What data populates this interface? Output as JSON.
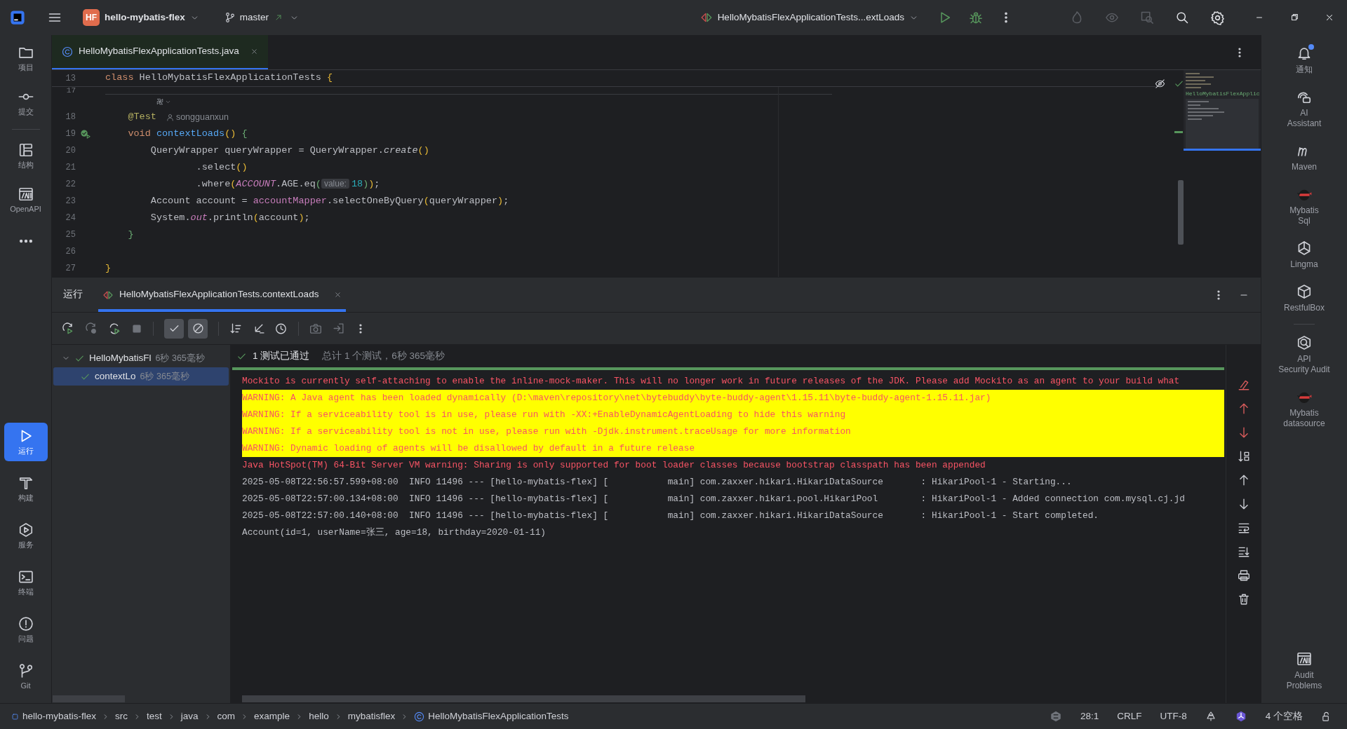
{
  "title_bar": {
    "project_badge": "HF",
    "project": "hello-mybatis-flex",
    "branch": "master",
    "run_config": "HelloMybatisFlexApplicationTests...extLoads"
  },
  "left_toolbar": {
    "top": [
      {
        "label": "项目",
        "selected": false
      },
      {
        "label": "提交",
        "selected": false
      },
      {
        "label": "结构",
        "selected": false
      },
      {
        "label": "OpenAPI",
        "selected": false
      }
    ],
    "bottom": [
      {
        "label": "运行",
        "selected": true
      },
      {
        "label": "构建",
        "selected": false
      },
      {
        "label": "服务",
        "selected": false
      },
      {
        "label": "终端",
        "selected": false
      },
      {
        "label": "问题",
        "selected": false
      },
      {
        "label": "Git",
        "selected": false
      }
    ]
  },
  "editor_tabs": [
    {
      "label": "HelloMybatisFlexApplicationTests.java",
      "selected": true
    }
  ],
  "editor": {
    "sticky_line": {
      "number": "13",
      "tokens": [
        {
          "t": "class ",
          "kind": "keyword"
        },
        {
          "t": "HelloMybatisFlexApplicationTests ",
          "kind": "plain"
        },
        {
          "t": "{",
          "kind": "bracket"
        }
      ]
    },
    "lines": [
      {
        "number": "17",
        "kind": "cut"
      },
      {
        "kind": "inlay"
      },
      {
        "number": "18",
        "kind": "code",
        "tokens": [
          {
            "t": "    @Test",
            "kind": "annotation"
          }
        ],
        "author": "songguanxun"
      },
      {
        "number": "19",
        "kind": "code",
        "run_marker": true,
        "tokens": [
          {
            "t": "    void ",
            "kind": "keyword"
          },
          {
            "t": "contextLoads",
            "kind": "function"
          },
          {
            "t": "() ",
            "kind": "bracket"
          },
          {
            "t": "{",
            "kind": "bracket2"
          }
        ]
      },
      {
        "number": "20",
        "kind": "code",
        "tokens": [
          {
            "t": "        QueryWrapper queryWrapper = QueryWrapper.",
            "kind": "plain"
          },
          {
            "t": "create",
            "kind": "italic"
          },
          {
            "t": "()",
            "kind": "bracket"
          }
        ]
      },
      {
        "number": "21",
        "kind": "code",
        "tokens": [
          {
            "t": "                .select",
            "kind": "plain"
          },
          {
            "t": "()",
            "kind": "bracket"
          }
        ]
      },
      {
        "number": "22",
        "kind": "code",
        "tokens": [
          {
            "t": "                .where",
            "kind": "plain"
          },
          {
            "t": "(",
            "kind": "bracket"
          },
          {
            "t": "ACCOUNT",
            "kind": "static"
          },
          {
            "t": ".AGE.eq",
            "kind": "plain"
          },
          {
            "t": "(",
            "kind": "bracket2"
          },
          {
            "t": "value:",
            "kind": "hint"
          },
          {
            "t": "18",
            "kind": "number"
          },
          {
            "t": ")",
            "kind": "bracket2"
          },
          {
            "t": ")",
            "kind": "bracket"
          },
          {
            "t": ";",
            "kind": "plain"
          }
        ]
      },
      {
        "number": "23",
        "kind": "code",
        "tokens": [
          {
            "t": "        Account account = ",
            "kind": "plain"
          },
          {
            "t": "accountMapper",
            "kind": "field"
          },
          {
            "t": ".selectOneByQuery",
            "kind": "plain"
          },
          {
            "t": "(",
            "kind": "bracket"
          },
          {
            "t": "queryWrapper",
            "kind": "plain"
          },
          {
            "t": ")",
            "kind": "bracket"
          },
          {
            "t": ";",
            "kind": "plain"
          }
        ]
      },
      {
        "number": "24",
        "kind": "code",
        "tokens": [
          {
            "t": "        System.",
            "kind": "plain"
          },
          {
            "t": "out",
            "kind": "static"
          },
          {
            "t": ".println",
            "kind": "plain"
          },
          {
            "t": "(",
            "kind": "bracket"
          },
          {
            "t": "account",
            "kind": "plain"
          },
          {
            "t": ")",
            "kind": "bracket"
          },
          {
            "t": ";",
            "kind": "plain"
          }
        ]
      },
      {
        "number": "25",
        "kind": "code",
        "tokens": [
          {
            "t": "    }",
            "kind": "bracket2"
          }
        ]
      },
      {
        "number": "26",
        "kind": "code"
      },
      {
        "number": "27",
        "kind": "code",
        "tokens": [
          {
            "t": "}",
            "kind": "bracket"
          }
        ]
      }
    ],
    "minimap_label": "HelloMybatisFlexApplic"
  },
  "run_panel": {
    "label": "运行",
    "tab": {
      "label": "HelloMybatisFlexApplicationTests.contextLoads",
      "selected": true
    },
    "filters": [
      {
        "on": true
      },
      {
        "on": true
      }
    ],
    "progress": {
      "level": 1
    },
    "tree": [
      {
        "name": "HelloMybatisFl",
        "time": "6秒 365毫秒",
        "passed": true,
        "expanded": true,
        "selected": false,
        "children": [
          {
            "name": "contextLo",
            "time": "6秒 365毫秒",
            "passed": true,
            "selected": true
          }
        ]
      }
    ],
    "summary": {
      "status": "1 测试已通过",
      "detail": "总计 1 个测试，6秒 365毫秒"
    },
    "console": [
      {
        "kind": "error",
        "text": "Mockito is currently self-attaching to enable the inline-mock-maker. This will no longer work in future releases of the JDK. Please add Mockito as an agent to your build what"
      },
      {
        "kind": "warning",
        "text": "WARNING: A Java agent has been loaded dynamically (D:\\maven\\repository\\net\\bytebuddy\\byte-buddy-agent\\1.15.11\\byte-buddy-agent-1.15.11.jar)"
      },
      {
        "kind": "warning",
        "text": "WARNING: If a serviceability tool is in use, please run with -XX:+EnableDynamicAgentLoading to hide this warning"
      },
      {
        "kind": "warning",
        "text": "WARNING: If a serviceability tool is not in use, please run with -Djdk.instrument.traceUsage for more information"
      },
      {
        "kind": "warning",
        "text": "WARNING: Dynamic loading of agents will be disallowed by default in a future release"
      },
      {
        "kind": "error",
        "text": "Java HotSpot(TM) 64-Bit Server VM warning: Sharing is only supported for boot loader classes because bootstrap classpath has been appended"
      },
      {
        "kind": "info",
        "text": "2025-05-08T22:56:57.599+08:00  INFO 11496 --- [hello-mybatis-flex] [           main] com.zaxxer.hikari.HikariDataSource       : HikariPool-1 - Starting..."
      },
      {
        "kind": "info",
        "text": "2025-05-08T22:57:00.134+08:00  INFO 11496 --- [hello-mybatis-flex] [           main] com.zaxxer.hikari.pool.HikariPool        : HikariPool-1 - Added connection com.mysql.cj.jd"
      },
      {
        "kind": "info",
        "text": "2025-05-08T22:57:00.140+08:00  INFO 11496 --- [hello-mybatis-flex] [           main] com.zaxxer.hikari.HikariDataSource       : HikariPool-1 - Start completed."
      },
      {
        "kind": "info",
        "text": "Account(id=1, userName=张三, age=18, birthday=2020-01-11)"
      }
    ]
  },
  "right_toolbar": {
    "top": [
      {
        "label": "通知",
        "badge": true
      },
      {
        "label": "AI\nAssistant",
        "badge": false
      },
      {
        "label": "Maven",
        "badge": false
      },
      {
        "label": "Mybatis\nSql",
        "badge": false
      },
      {
        "label": "Lingma",
        "badge": false
      },
      {
        "label": "RestfulBox",
        "badge": false
      },
      {
        "label": "API\nSecurity Audit",
        "badge": false
      },
      {
        "label": "Mybatis\ndatasource",
        "badge": false
      }
    ],
    "bottom": [
      {
        "label": "Audit\nProblems",
        "badge": false
      }
    ]
  },
  "status_bar": {
    "breadcrumbs": [
      "hello-mybatis-flex",
      "src",
      "test",
      "java",
      "com",
      "example",
      "hello",
      "mybatisflex",
      "HelloMybatisFlexApplicationTests"
    ],
    "position": "28:1",
    "line_ending": "CRLF",
    "encoding": "UTF-8",
    "indent": "4 个空格"
  }
}
